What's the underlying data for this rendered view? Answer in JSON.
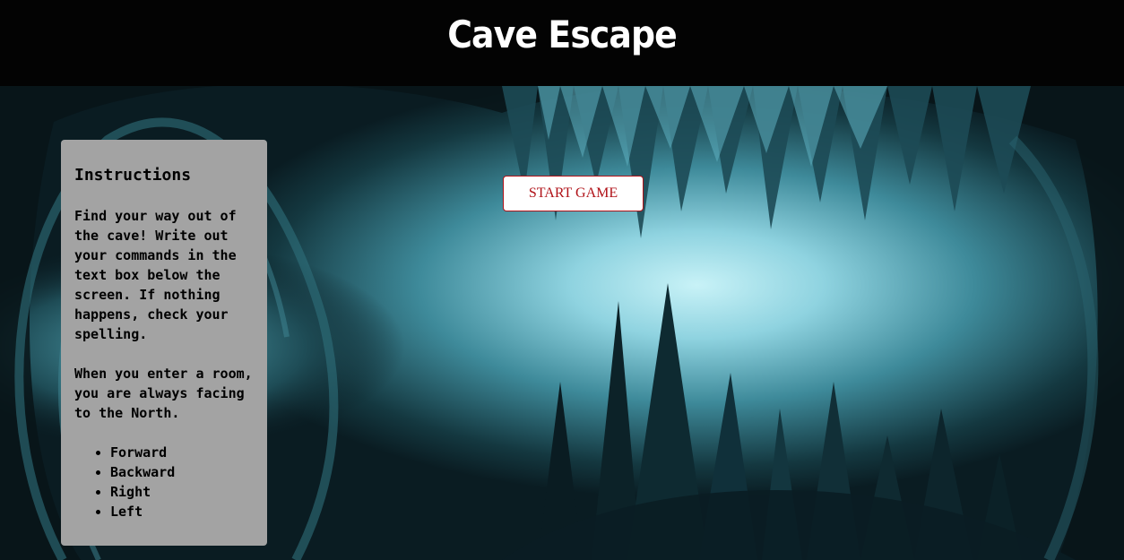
{
  "header": {
    "title": "Cave Escape"
  },
  "start_button": {
    "label": "START GAME"
  },
  "instructions": {
    "heading": "Instructions",
    "paragraph_1": "Find your way out of the cave! Write out your commands in the text box below the screen. If nothing happens, check your spelling.",
    "paragraph_2": "When you enter a room, you are always facing to the North.",
    "commands": [
      "Forward",
      "Backward",
      "Right",
      "Left"
    ]
  },
  "colors": {
    "header_background": "#030303",
    "panel_background": "#a3a3a3",
    "button_text": "#b01218",
    "button_border": "#b01218",
    "cave_glow": "#a8e6f0",
    "cave_dark": "#0a1c22"
  }
}
